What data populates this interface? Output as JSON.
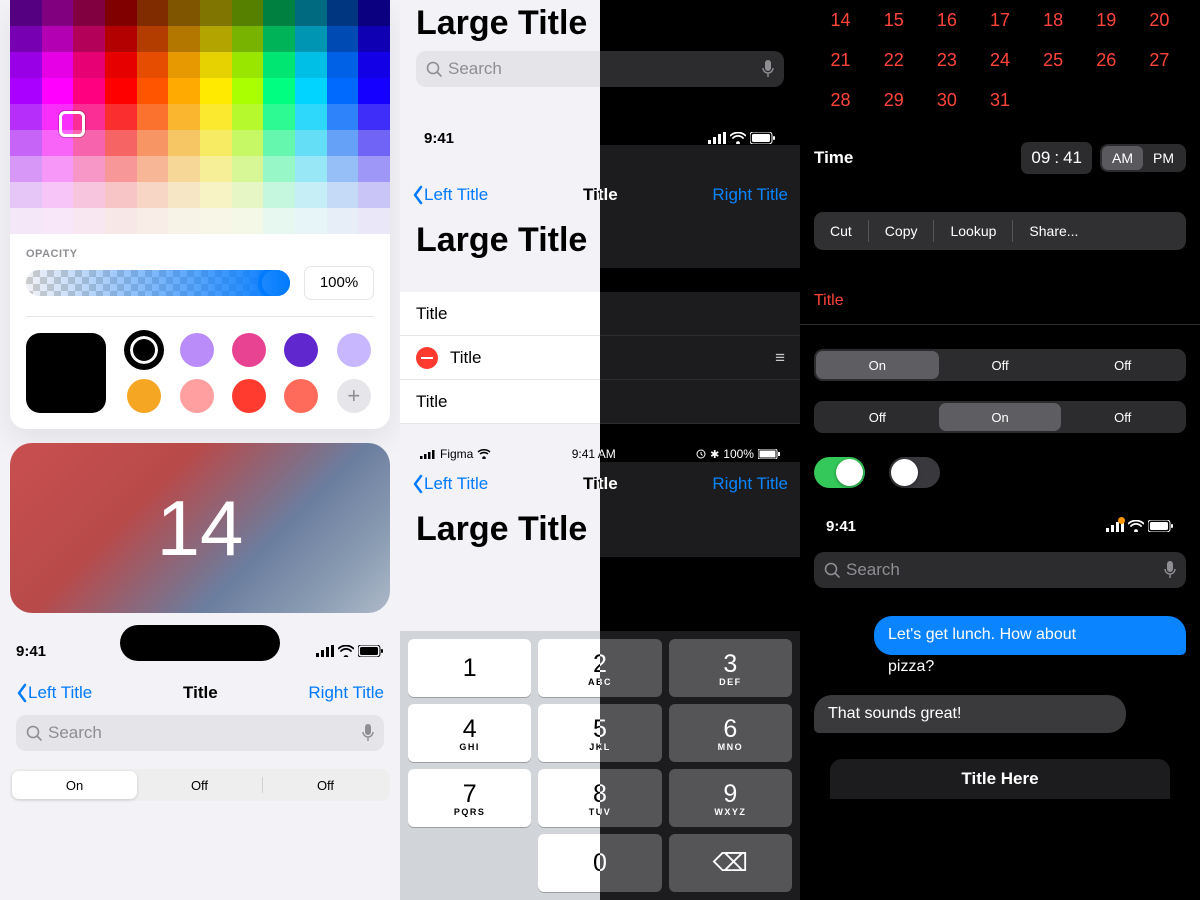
{
  "col1": {
    "opacity_label": "OPACITY",
    "opacity_value": "100%",
    "swatches": {
      "big": "#000000",
      "items": [
        "#000000",
        "#b98cf9",
        "#e84393",
        "#5f27cd",
        "#c8b6ff",
        "#f5a623",
        "#ff9f9f",
        "#ff3b30",
        "#ff6b5b"
      ]
    },
    "widget_number": "14",
    "status_time": "9:41",
    "nav": {
      "left": "Left Title",
      "center": "Title",
      "right": "Right Title"
    },
    "search_placeholder": "Search",
    "segment": [
      "On",
      "Off",
      "Off"
    ]
  },
  "col2": {
    "block1": {
      "large_title": "Large Title",
      "search_placeholder": "Search"
    },
    "block2": {
      "status_time": "9:41",
      "nav": {
        "left": "Left Title",
        "center": "Title",
        "right": "Right Title"
      },
      "large_title": "Large Title",
      "list": [
        "Title",
        "Title",
        "Title"
      ]
    },
    "block3": {
      "carrier": "Figma",
      "status_time": "9:41 AM",
      "batt": "100%",
      "nav": {
        "left": "Left Title",
        "center": "Title",
        "right": "Right Title"
      },
      "large_title": "Large Title"
    },
    "keypad": [
      {
        "n": "1",
        "s": ""
      },
      {
        "n": "2",
        "s": "ABC"
      },
      {
        "n": "3",
        "s": "DEF"
      },
      {
        "n": "4",
        "s": "GHI"
      },
      {
        "n": "5",
        "s": "JKL"
      },
      {
        "n": "6",
        "s": "MNO"
      },
      {
        "n": "7",
        "s": "PQRS"
      },
      {
        "n": "8",
        "s": "TUV"
      },
      {
        "n": "9",
        "s": "WXYZ"
      },
      {
        "n": "",
        "s": ""
      },
      {
        "n": "0",
        "s": ""
      },
      {
        "n": "⌫",
        "s": ""
      }
    ]
  },
  "col3": {
    "calendar_weeks": [
      [
        "14",
        "15",
        "16",
        "17",
        "18",
        "19",
        "20"
      ],
      [
        "21",
        "22",
        "23",
        "24",
        "25",
        "26",
        "27"
      ],
      [
        "28",
        "29",
        "30",
        "31",
        "",
        "",
        ""
      ]
    ],
    "time": {
      "label": "Time",
      "hour": "09",
      "minute": "41",
      "am": "AM",
      "pm": "PM"
    },
    "context_menu": [
      "Cut",
      "Copy",
      "Lookup",
      "Share..."
    ],
    "red_title": "Title",
    "seg1": [
      "On",
      "Off",
      "Off"
    ],
    "seg2": [
      "Off",
      "On",
      "Off"
    ],
    "status_time": "9:41",
    "search_placeholder": "Search",
    "msg1": "Let's get lunch. How about",
    "msg1b": "pizza?",
    "msg2": "That sounds great!",
    "sheet_title": "Title Here"
  }
}
